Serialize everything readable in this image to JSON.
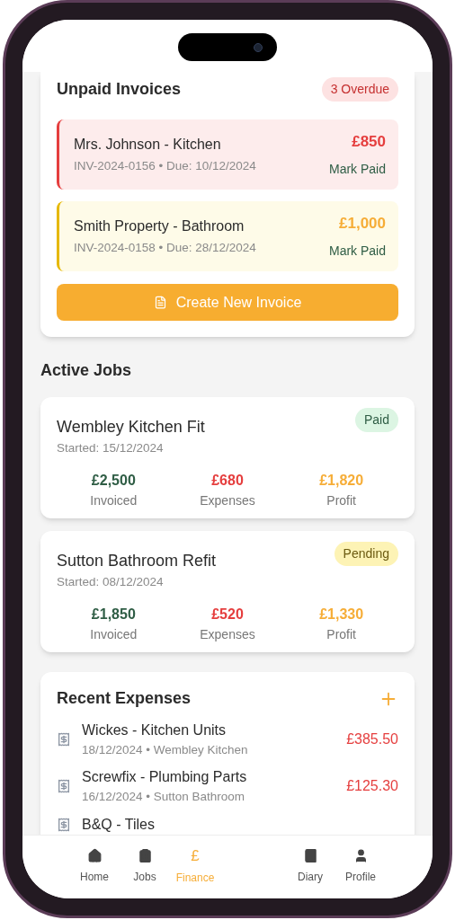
{
  "invoices": {
    "title": "Unpaid Invoices",
    "badge": "3 Overdue",
    "items": [
      {
        "client": "Mrs. Johnson - Kitchen",
        "meta": "INV-2024-0156 • Due: 10/12/2024",
        "amount": "£850",
        "action": "Mark Paid",
        "kind": "overdue"
      },
      {
        "client": "Smith Property - Bathroom",
        "meta": "INV-2024-0158 • Due: 28/12/2024",
        "amount": "£1,000",
        "action": "Mark Paid",
        "kind": "due"
      }
    ],
    "create_button": "Create New Invoice"
  },
  "active_jobs": {
    "title": "Active Jobs",
    "jobs": [
      {
        "name": "Wembley Kitchen Fit",
        "started": "Started: 15/12/2024",
        "status_label": "Paid",
        "kind": "paid",
        "stats": [
          {
            "value": "£2,500",
            "label": "Invoiced",
            "kind": "invoiced"
          },
          {
            "value": "£680",
            "label": "Expenses",
            "kind": "expenses"
          },
          {
            "value": "£1,820",
            "label": "Profit",
            "kind": "profit"
          }
        ]
      },
      {
        "name": "Sutton Bathroom Refit",
        "started": "Started: 08/12/2024",
        "status_label": "Pending",
        "kind": "pending",
        "stats": [
          {
            "value": "£1,850",
            "label": "Invoiced",
            "kind": "invoiced"
          },
          {
            "value": "£520",
            "label": "Expenses",
            "kind": "expenses"
          },
          {
            "value": "£1,330",
            "label": "Profit",
            "kind": "profit"
          }
        ]
      }
    ]
  },
  "recent_expenses": {
    "title": "Recent Expenses",
    "items": [
      {
        "title": "Wickes - Kitchen Units",
        "meta": "18/12/2024 • Wembley Kitchen",
        "amount": "£385.50"
      },
      {
        "title": "Screwfix - Plumbing Parts",
        "meta": "16/12/2024 • Sutton Bathroom",
        "amount": "£125.30"
      },
      {
        "title": "B&Q - Tiles"
      }
    ]
  },
  "nav": [
    {
      "label": "Home",
      "kind": "home",
      "selected": false
    },
    {
      "label": "Jobs",
      "kind": "jobs",
      "selected": false
    },
    {
      "label": "Finance",
      "kind": "glyph",
      "glyph": "£",
      "selected": true
    },
    {
      "label": "Diary",
      "kind": "diary",
      "selected": false
    },
    {
      "label": "Profile",
      "kind": "profile",
      "selected": false
    }
  ]
}
